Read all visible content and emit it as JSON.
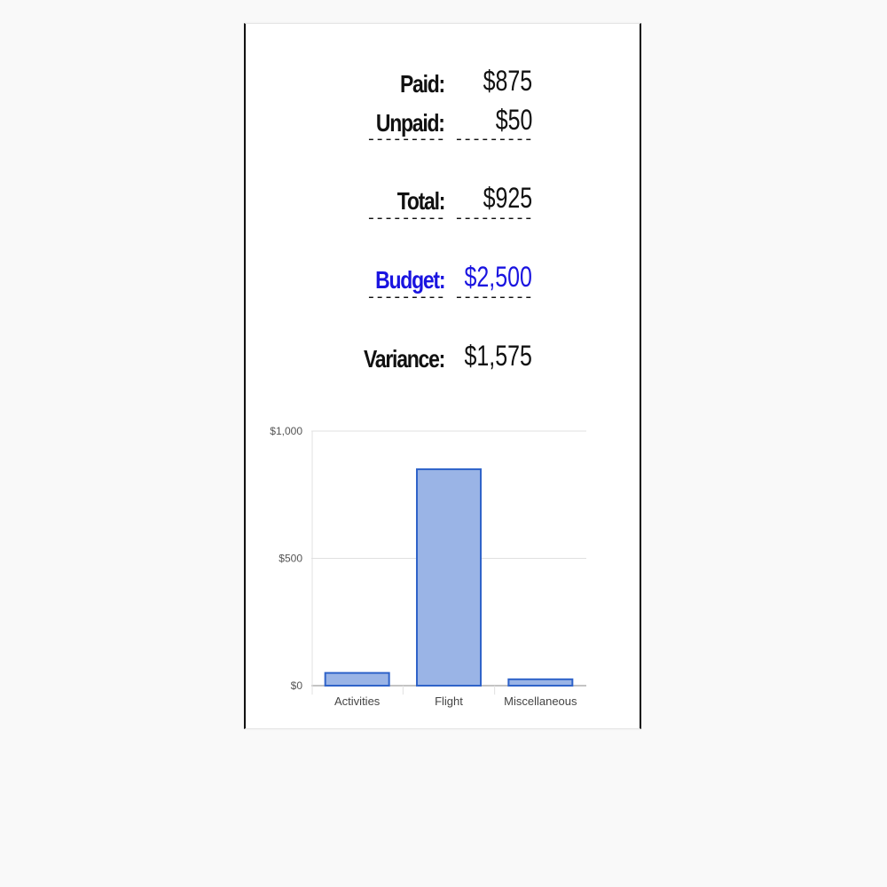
{
  "summary": {
    "paid_label": "Paid:",
    "paid_value": "$875",
    "unpaid_label": "Unpaid:",
    "unpaid_value": "$50",
    "separator": "---------",
    "total_label": "Total:",
    "total_value": "$925",
    "budget_label": "Budget:",
    "budget_value": "$2,500",
    "variance_label": "Variance:",
    "variance_value": "$1,575"
  },
  "colors": {
    "budget": "#1a14e0",
    "bar_fill": "#9ab4e6",
    "bar_stroke": "#2f63c9",
    "grid": "#e0e0e0",
    "axis_text": "#555555"
  },
  "chart_data": {
    "type": "bar",
    "categories": [
      "Activities",
      "Flight",
      "Miscellaneous"
    ],
    "values": [
      50,
      850,
      25
    ],
    "title": "",
    "xlabel": "",
    "ylabel": "",
    "ylim": [
      0,
      1000
    ],
    "yticks": [
      0,
      500,
      1000
    ],
    "ytick_labels": [
      "$0",
      "$500",
      "$1,000"
    ],
    "grid": true
  }
}
